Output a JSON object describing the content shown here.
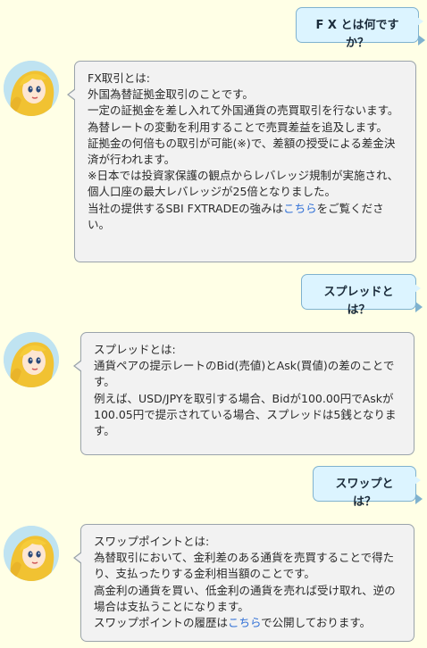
{
  "messages": {
    "q1": "F X とは何ですか？",
    "a1": {
      "l1": "FX取引とは:",
      "l2": "外国為替証拠金取引のことです。",
      "l3": "一定の証拠金を差し入れて外国通貨の売買取引を行ないます。",
      "l4": "為替レートの変動を利用することで売買差益を追及します。",
      "l5": "証拠金の何倍もの取引が可能(※)で、差額の授受による差金決済が行われます。",
      "l6": "※日本では投資家保護の観点からレバレッジ規制が実施され、個人口座の最大レバレッジが25倍となりました。",
      "l7_prefix": "当社の提供するSBI FXTRADEの強みは",
      "l7_link": "こちら",
      "l7_suffix": "をご覧ください。"
    },
    "q2": "スプレッドとは？",
    "a2": {
      "l1": "スプレッドとは:",
      "l2": "通貨ペアの提示レートのBid(売値)とAsk(買値)の差のことです。",
      "l3": "例えば、USD/JPYを取引する場合、Bidが100.00円でAskが100.05円で提示されている場合、スプレッドは5銭となります。"
    },
    "q3": "スワップとは？",
    "a3": {
      "l1": "スワップポイントとは:",
      "l2": "為替取引において、金利差のある通貨を売買することで得たり、支払ったりする金利相当額のことです。",
      "l3": "高金利の通貨を買い、低金利の通貨を売れば受け取れ、逆の場合は支払うことになります。",
      "l4_prefix": "スワップポイントの履歴は",
      "l4_link": "こちら",
      "l4_suffix": "で公開しております。"
    }
  },
  "colors": {
    "background": "#ffffe6",
    "user_bubble": "#dcf4ff",
    "bot_bubble": "#f2f2f2",
    "link": "#2f6fd6"
  },
  "icons": {
    "avatar": "assistant-avatar-icon"
  }
}
